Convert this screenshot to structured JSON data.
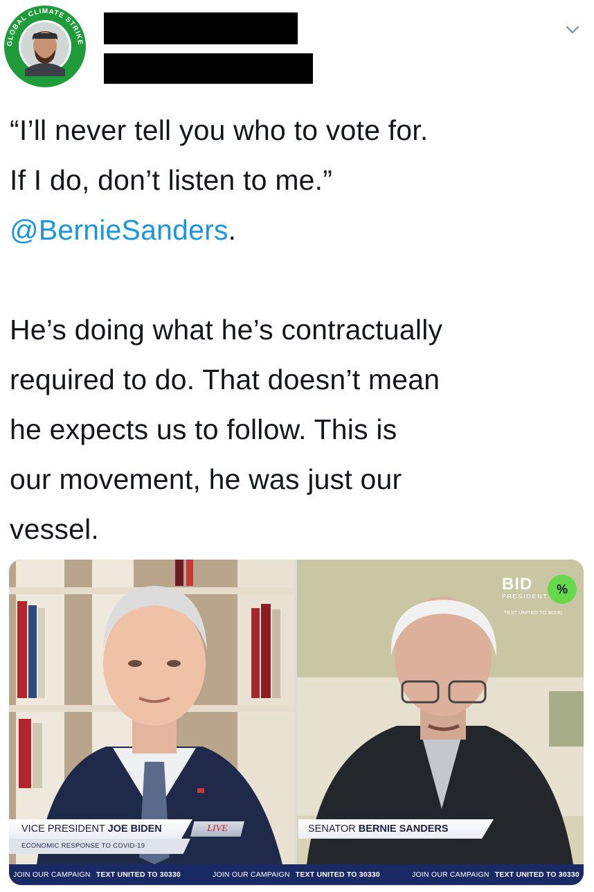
{
  "author": {
    "avatar_ring_text": "GLOBAL CLIMATE STRIKE",
    "name_redacted": true,
    "handle_redacted": true
  },
  "menu": {
    "icon": "chevron-down-icon"
  },
  "tweet": {
    "quote_line1": "“I’ll never tell you who to vote for.",
    "quote_line2": "If I do, don’t listen to me.”",
    "mention": "@BernieSanders",
    "mention_suffix": ".",
    "body_line1": "He’s doing what he’s contractually",
    "body_line2": "required to do. That doesn’t mean",
    "body_line3": "he expects us to follow. This is",
    "body_line4": "our movement, he was just our",
    "body_line5": "vessel."
  },
  "media": {
    "left_name_prefix": "VICE PRESIDENT ",
    "left_name_bold": "JOE BIDEN",
    "left_live": "LIVE",
    "left_subtitle": "ECONOMIC RESPONSE TO COVID-19",
    "right_name_prefix": "SENATOR ",
    "right_name_bold": "BERNIE SANDERS",
    "bug_logo": "BID",
    "bug_sub": "PRESIDENT",
    "bug_badge": "%",
    "bug_text": "TEXT UNITED TO 30330",
    "ticker": [
      {
        "a": "JOIN OUR CAMPAIGN",
        "b": "TEXT UNITED TO 30330"
      },
      {
        "a": "JOIN OUR CAMPAIGN",
        "b": "TEXT UNITED TO 30330"
      },
      {
        "a": "JOIN OUR CAMPAIGN",
        "b": "TEXT UNITED TO 30330"
      }
    ]
  },
  "colors": {
    "mention": "#1b95e0",
    "ticker_bg": "#1a2a64",
    "avatar_ring": "#1f9b3a"
  }
}
